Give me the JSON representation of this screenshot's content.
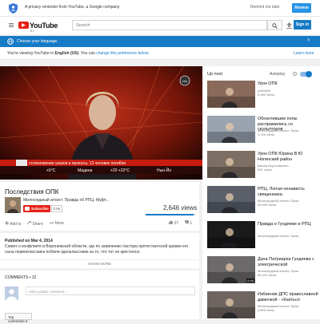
{
  "privacy": {
    "text": "A privacy reminder from YouTube, a Google company",
    "remind_label": "Remind me later",
    "review_label": "Review"
  },
  "masthead": {
    "logo_text": "YouTube",
    "logo_country": "BY",
    "search_placeholder": "Search",
    "signin_label": "Sign in"
  },
  "language": {
    "choose_text": "Choose your language.",
    "close_label": "×",
    "info_prefix": "You're viewing YouTube in ",
    "info_lang": "English (US)",
    "info_mid": ". You can ",
    "info_link": "change this preference below",
    "info_suffix": ".",
    "learn_more": "Learn more"
  },
  "video": {
    "title": "Последствия ОПК",
    "channel": "Милосердный атеист. Правда об РПЦ. Муфт...",
    "subscribe_label": "Subscribe",
    "subscriber_count": "3.5K",
    "views": "2,646 views",
    "like_ratio": 0.97,
    "actions": {
      "add_to": "Add to",
      "share": "Share",
      "more": "More"
    },
    "likes": "37",
    "dislikes": "1",
    "overlay": {
      "channel_logo": "ren",
      "ticker": "столкновение указов в прокаты, 13 человек погибли",
      "temp_left": "+5°C",
      "city": "Мадина",
      "temp_mid": "+20 +22°C",
      "city_right": "Нью-Йо"
    }
  },
  "description": {
    "published": "Published on Mar 4, 2014",
    "text": "Сюжет о конфликте в Воронежской области, где по заявлению пастора протестантской церкви его сына первоклассника побили одноклассники за то, что тот не крестился.",
    "show_more": "SHOW MORE"
  },
  "comments": {
    "title": "COMMENTS • 12",
    "placeholder": "Add a public comment...",
    "sort_label": "Top comments ▾"
  },
  "sidebar": {
    "up_next": "Up next",
    "autoplay": "Autoplay",
    "autoplay_info": "i",
    "autoplay_on": true,
    "items": [
      {
        "title": "Урок ОПК",
        "channel": "pollmy69",
        "views": "5,960 views",
        "duration": "",
        "thumb_color": "#8a6a5a"
      },
      {
        "title": "Обнаглевшие попы распрамились со скульпторов",
        "channel": "Милосердный атеист. Прав",
        "views": "3,120 views",
        "duration": "",
        "thumb_color": "#9aa3b0"
      },
      {
        "title": "Урок ОПК Юрина В Ю Ногинский район",
        "channel": "Школа Борисовского",
        "views": "941 views",
        "duration": "",
        "thumb_color": "#7e6f64"
      },
      {
        "title": "РПЦ. Лютая ненависть священника",
        "channel": "Милосердный атеист. Прав",
        "views": "55,993 views",
        "duration": "",
        "thumb_color": "#5a5f6a"
      },
      {
        "title": "Правда о Гундяеве и РПЦ",
        "channel": "Милосердный атеист. Прав",
        "views": "",
        "duration": "",
        "thumb_color": "#1a1a1a"
      },
      {
        "title": "Дача Патриарха Гундяева с электрической",
        "channel": "Милосердный атеист. Прав",
        "views": "80,415 views",
        "duration": "6:46",
        "thumb_color": "#6d6a6b"
      },
      {
        "title": "Избиение ДПС православной дамочкой - «Каяться",
        "channel": "Милосердный атеист. Прав",
        "views": "4,695 views",
        "duration": "",
        "thumb_color": "#6e6560"
      }
    ]
  },
  "colors": {
    "brand_red": "#e62117",
    "accent_blue": "#167ac6",
    "review_blue": "#2793e6"
  }
}
